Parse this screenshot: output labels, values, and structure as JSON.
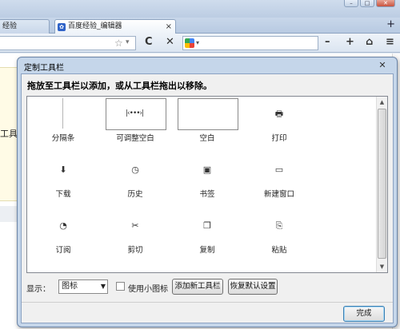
{
  "browser": {
    "tabs": [
      {
        "label": "经验"
      },
      {
        "label": "百度经验_编辑器"
      }
    ],
    "new_tab": "+",
    "nav": {
      "reload": "C",
      "stop": "✕",
      "search_caret": "▾",
      "zoom_out": "–",
      "zoom_in": "+",
      "home": "⌂",
      "bookmarks": "≡"
    },
    "page_text": "工具"
  },
  "dialog": {
    "title": "定制工具栏",
    "close": "✕",
    "instruction": "拖放至工具栏以添加，或从工具栏拖出以移除。",
    "items": [
      {
        "label": "分隔条",
        "icon": "separator"
      },
      {
        "label": "可调整空白",
        "icon": "flexible-space",
        "glyph": "|‹•••›|"
      },
      {
        "label": "空白",
        "icon": "space"
      },
      {
        "label": "打印",
        "icon": "printer-icon",
        "glyph": "🖶"
      },
      {
        "label": "下载",
        "icon": "download-icon",
        "glyph": "⬇"
      },
      {
        "label": "历史",
        "icon": "history-clock-icon",
        "glyph": "◷"
      },
      {
        "label": "书签",
        "icon": "bookmark-star-icon",
        "glyph": "▣"
      },
      {
        "label": "新建窗口",
        "icon": "new-window-icon",
        "glyph": "▭"
      },
      {
        "label": "订阅",
        "icon": "rss-feed-icon",
        "glyph": "◔"
      },
      {
        "label": "剪切",
        "icon": "scissors-icon",
        "glyph": "✂"
      },
      {
        "label": "复制",
        "icon": "copy-icon",
        "glyph": "❐"
      },
      {
        "label": "粘贴",
        "icon": "paste-clipboard-icon",
        "glyph": "⎘"
      }
    ],
    "show_label": "显示：",
    "show_value": "图标",
    "small_icons_label": "使用小图标",
    "add_toolbar_button": "添加新工具栏",
    "restore_default_button": "恢复默认设置",
    "done_button": "完成"
  }
}
